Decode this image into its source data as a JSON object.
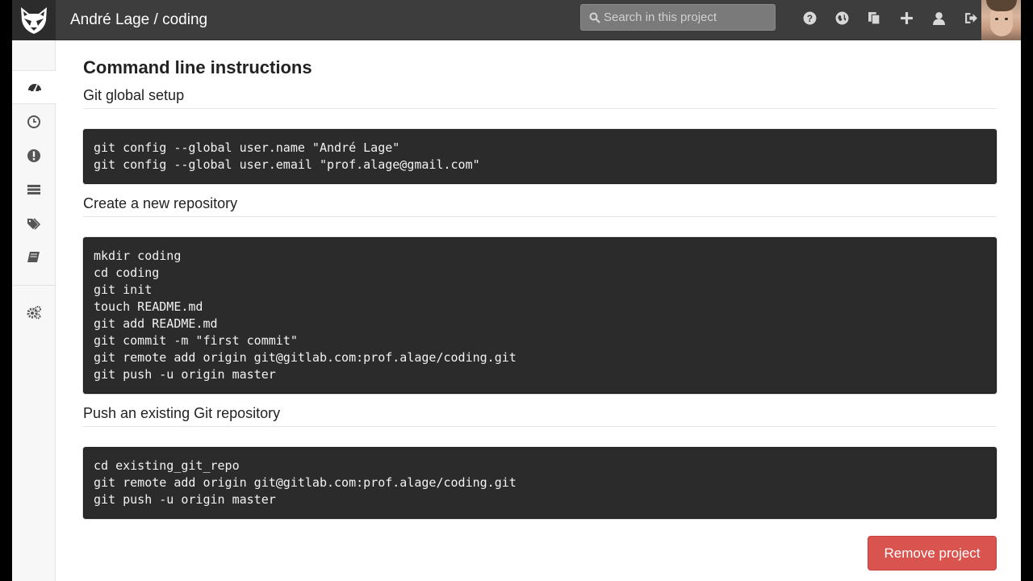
{
  "header": {
    "project_title": "André Lage / coding",
    "search_placeholder": "Search in this project",
    "icons": [
      "help-icon",
      "globe-icon",
      "copy-icon",
      "plus-icon",
      "user-icon",
      "sign-out-icon"
    ]
  },
  "sidebar": {
    "items": [
      {
        "name": "dashboard",
        "icon": "dashboard-icon"
      },
      {
        "name": "activity",
        "icon": "clock-icon"
      },
      {
        "name": "issues",
        "icon": "exclamation-icon"
      },
      {
        "name": "files",
        "icon": "list-icon"
      },
      {
        "name": "labels",
        "icon": "tags-icon"
      },
      {
        "name": "wiki",
        "icon": "book-icon"
      },
      {
        "name": "settings",
        "icon": "cogs-icon"
      }
    ]
  },
  "main": {
    "title": "Command line instructions",
    "sections": [
      {
        "title": "Git global setup",
        "lines": [
          "git config --global user.name \"André Lage\"",
          "git config --global user.email \"prof.alage@gmail.com\""
        ]
      },
      {
        "title": "Create a new repository",
        "lines": [
          "mkdir coding",
          "cd coding",
          "git init",
          "touch README.md",
          "git add README.md",
          "git commit -m \"first commit\"",
          "git remote add origin git@gitlab.com:prof.alage/coding.git",
          "git push -u origin master"
        ]
      },
      {
        "title": "Push an existing Git repository",
        "lines": [
          "cd existing_git_repo",
          "git remote add origin git@gitlab.com:prof.alage/coding.git",
          "git push -u origin master"
        ]
      }
    ],
    "remove_button": "Remove project"
  },
  "colors": {
    "header_bg": "#3d3d3d",
    "code_bg": "#2b2b2b",
    "danger": "#d9534f"
  }
}
